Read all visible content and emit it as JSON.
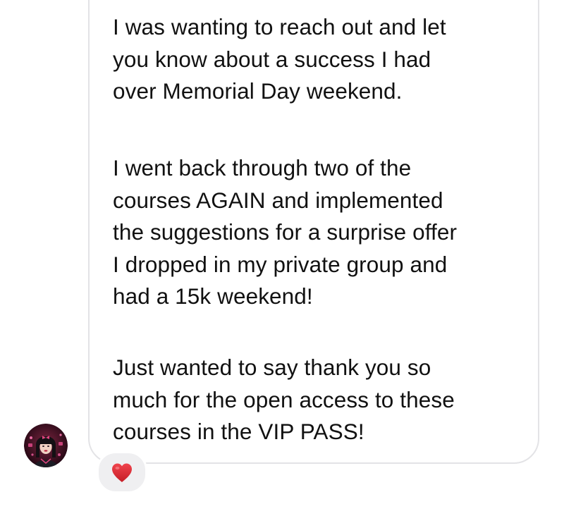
{
  "conversation": {
    "message": {
      "paragraphs": [
        "I was wanting to reach out and let\nyou know about a success I had\nover Memorial Day weekend.",
        "I went back through two of the\ncourses AGAIN and implemented\nthe suggestions for a surprise offer\nI dropped in my private group and\nhad a 15k weekend!",
        "Just wanted to say thank you so\nmuch for the open access to these\ncourses in the VIP PASS!"
      ],
      "reaction": {
        "icon": "heart-icon",
        "color": "#e0272f"
      }
    },
    "sender": {
      "avatar_icon": "avatar"
    }
  },
  "colors": {
    "text": "#111111",
    "bubble_border": "#e3e3e6",
    "reaction_bg": "#efeff1",
    "background": "#ffffff"
  }
}
